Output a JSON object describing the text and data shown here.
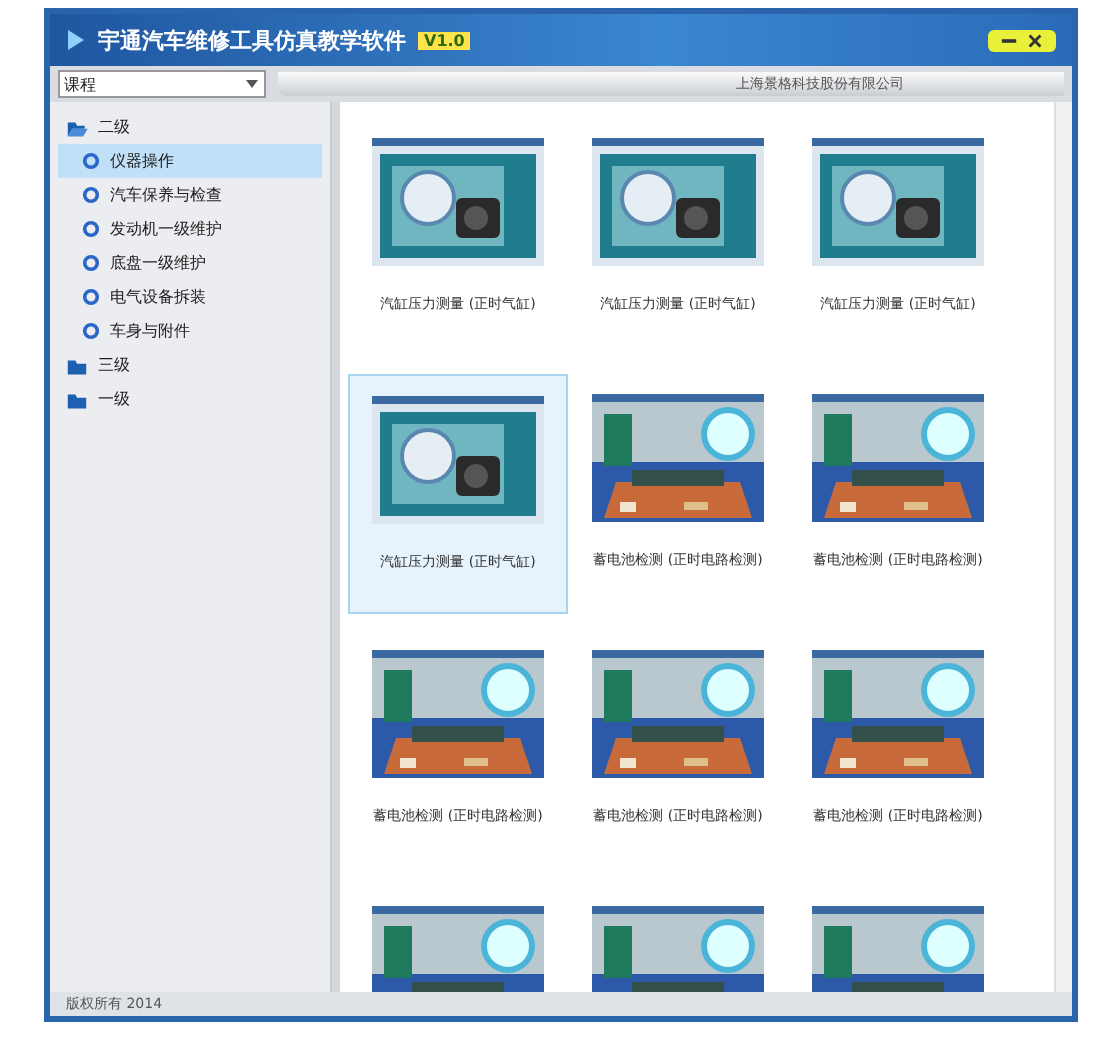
{
  "window": {
    "title": "宇通汽车维修工具仿真教学软件",
    "version": "V1.0"
  },
  "toolbar": {
    "dropdown": {
      "value": "课程"
    },
    "company": "上海景格科技股份有限公司"
  },
  "sidebar": {
    "items": [
      {
        "label": "二级",
        "expanded": true,
        "selected": false,
        "children": [
          {
            "label": "仪器操作",
            "selected": true
          },
          {
            "label": "汽车保养与检查",
            "selected": false
          },
          {
            "label": "发动机一级维护",
            "selected": false
          },
          {
            "label": "底盘一级维护",
            "selected": false
          },
          {
            "label": "电气设备拆装",
            "selected": false
          },
          {
            "label": "车身与附件",
            "selected": false
          }
        ]
      },
      {
        "label": "三级",
        "expanded": false,
        "selected": false
      },
      {
        "label": "一级",
        "expanded": false,
        "selected": false
      }
    ]
  },
  "gallery": {
    "items": [
      {
        "kind": "gauge",
        "caption": "汽缸压力测量 (正时气缸)",
        "selected": false
      },
      {
        "kind": "gauge",
        "caption": "汽缸压力测量 (正时气缸)",
        "selected": false
      },
      {
        "kind": "gauge",
        "caption": "汽缸压力测量 (正时气缸)",
        "selected": false
      },
      {
        "kind": "gauge",
        "caption": "汽缸压力测量 (正时气缸)",
        "selected": true
      },
      {
        "kind": "bench",
        "caption": "蓄电池检测 (正时电路检测)",
        "selected": false
      },
      {
        "kind": "bench",
        "caption": "蓄电池检测 (正时电路检测)",
        "selected": false
      },
      {
        "kind": "bench",
        "caption": "蓄电池检测 (正时电路检测)",
        "selected": false
      },
      {
        "kind": "bench",
        "caption": "蓄电池检测 (正时电路检测)",
        "selected": false
      },
      {
        "kind": "bench",
        "caption": "蓄电池检测 (正时电路检测)",
        "selected": false
      },
      {
        "kind": "bench",
        "selected": false
      },
      {
        "kind": "bench",
        "selected": false
      },
      {
        "kind": "bench",
        "selected": false
      }
    ]
  },
  "status_bar": {
    "text": "版权所有 2014"
  }
}
